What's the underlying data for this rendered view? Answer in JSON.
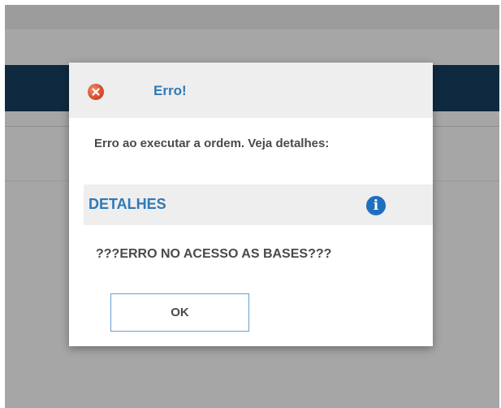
{
  "dialog": {
    "title": "Erro!",
    "icon": "error-icon",
    "message": "Erro ao executar a ordem. Veja detalhes:",
    "details": {
      "label": "DETALHES",
      "icon": "info-icon",
      "icon_glyph": "i",
      "text": "???ERRO NO ACESSO AS BASES???"
    },
    "ok_label": "OK"
  },
  "colors": {
    "title": "#2f79b8",
    "header_bar": "#0f2a40",
    "error_icon": "#d9502f",
    "info_icon": "#1f6fbf"
  }
}
